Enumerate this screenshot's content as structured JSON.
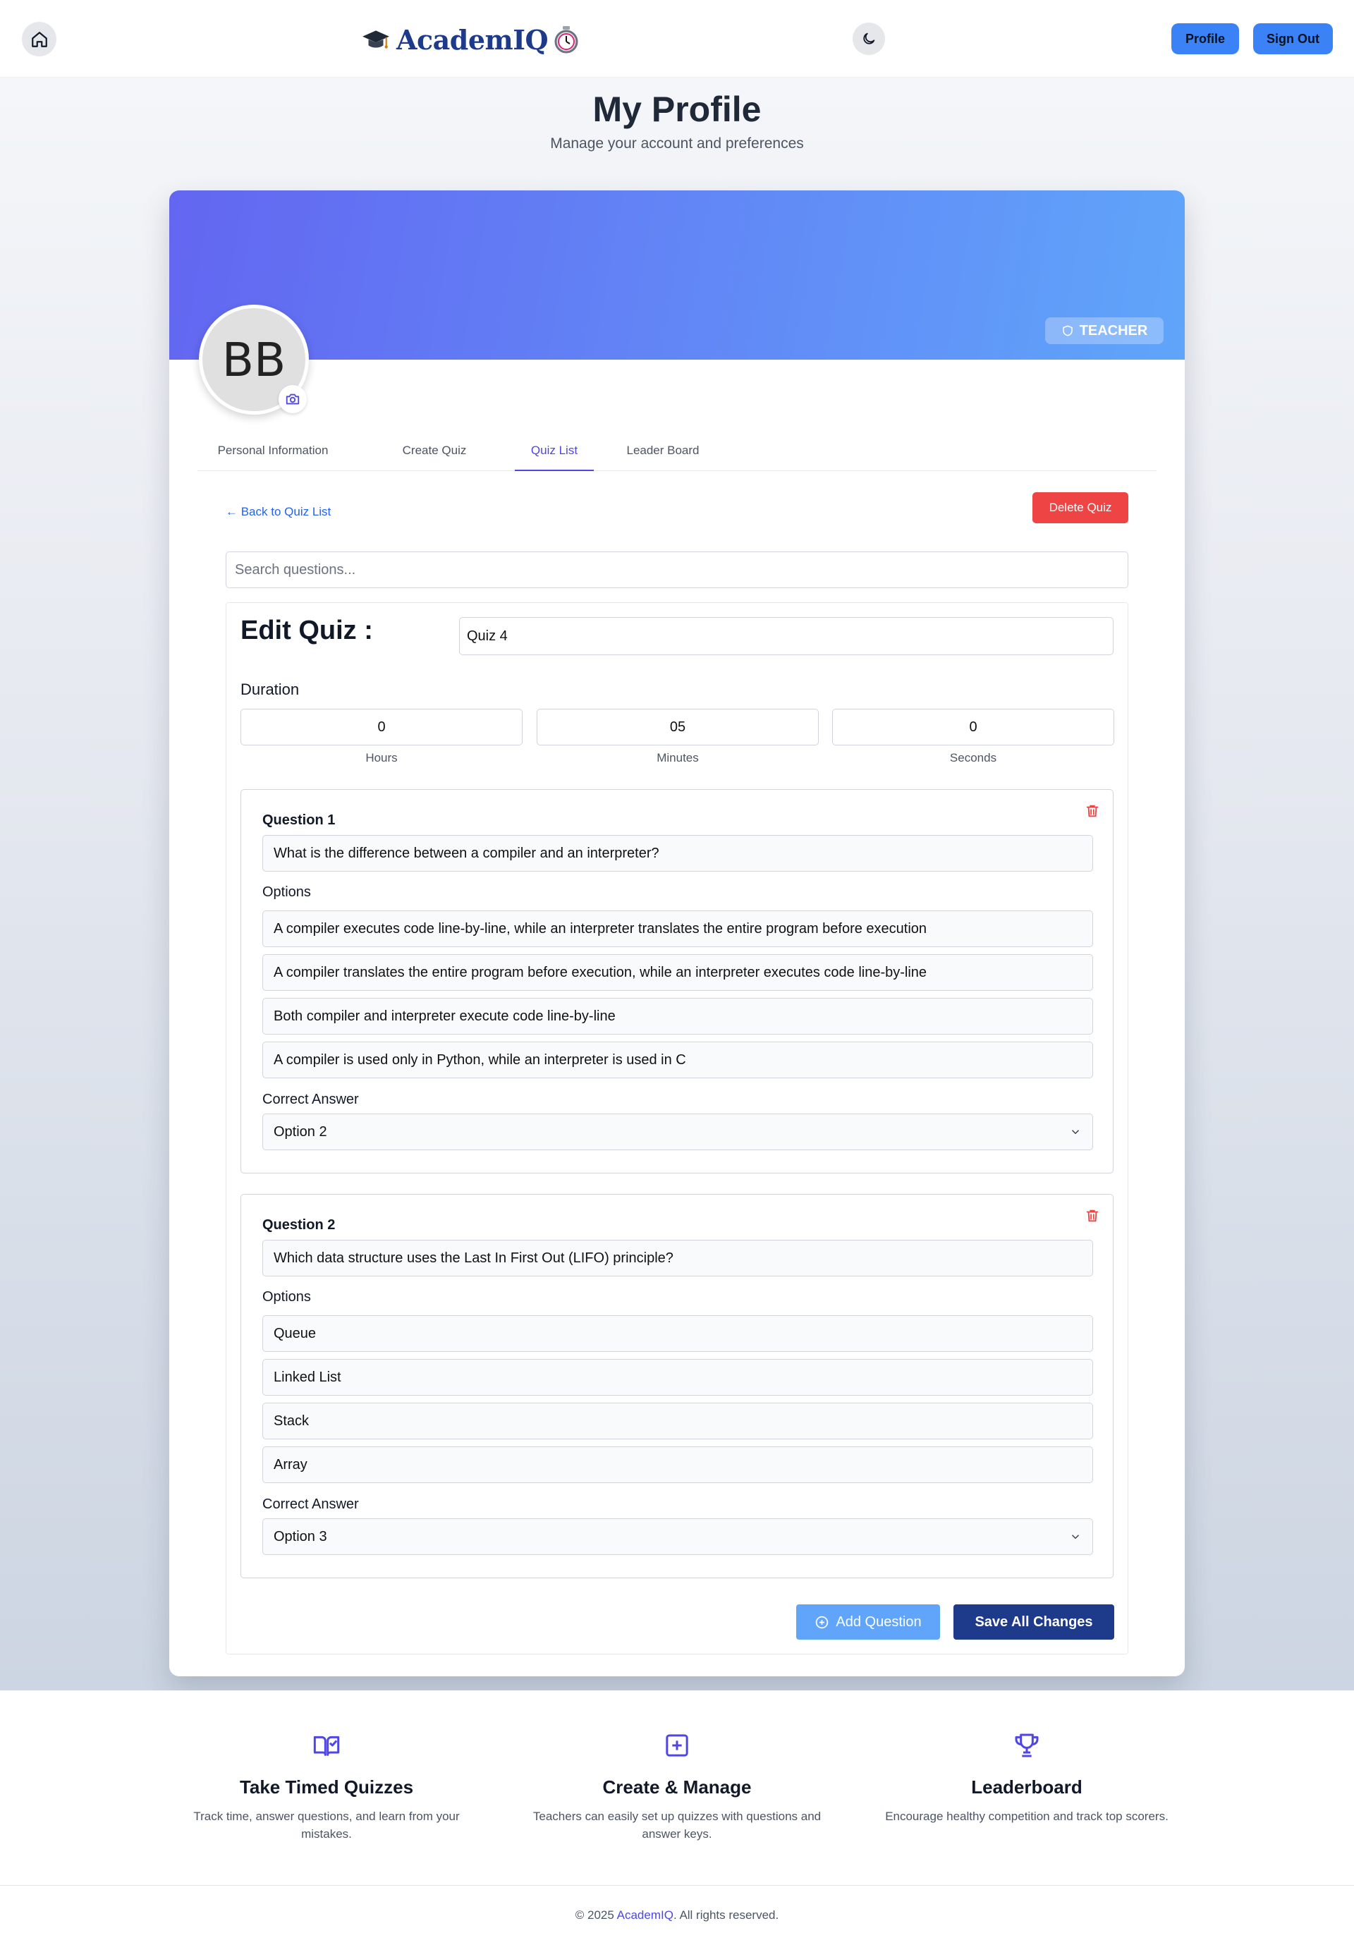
{
  "header": {
    "brand": "AcademIQ",
    "profile_label": "Profile",
    "signout_label": "Sign Out"
  },
  "page": {
    "title": "My Profile",
    "subtitle": "Manage your account and preferences"
  },
  "profile": {
    "initials": "BB",
    "role": "TEACHER"
  },
  "tabs": [
    {
      "label": "Personal Information",
      "active": false
    },
    {
      "label": "Create Quiz",
      "active": false
    },
    {
      "label": "Quiz List",
      "active": true
    },
    {
      "label": "Leader Board",
      "active": false
    }
  ],
  "quiz_editor": {
    "back_label": "← Back to Quiz List",
    "delete_label": "Delete Quiz",
    "search_placeholder": "Search questions...",
    "edit_title": "Edit Quiz :",
    "quiz_name": "Quiz 4",
    "duration_label": "Duration",
    "duration": {
      "hours": "0",
      "minutes": "05",
      "seconds": "0",
      "hours_label": "Hours",
      "minutes_label": "Minutes",
      "seconds_label": "Seconds"
    },
    "options_label": "Options",
    "correct_label": "Correct Answer",
    "questions": [
      {
        "label": "Question 1",
        "text": "What is the difference between a compiler and an interpreter?",
        "options": [
          "A compiler executes code line-by-line, while an interpreter translates the entire program before execution",
          "A compiler translates the entire program before execution, while an interpreter executes code line-by-line",
          "Both compiler and interpreter execute code line-by-line",
          "A compiler is used only in Python, while an interpreter is used in C"
        ],
        "correct": "Option 2"
      },
      {
        "label": "Question 2",
        "text": "Which data structure uses the Last In First Out (LIFO) principle?",
        "options": [
          "Queue",
          "Linked List",
          "Stack",
          "Array"
        ],
        "correct": "Option 3"
      }
    ],
    "add_question_label": "Add Question",
    "save_label": "Save All Changes"
  },
  "features": [
    {
      "title": "Take Timed Quizzes",
      "text": "Track time, answer questions, and learn from your mistakes.",
      "icon": "book-check-icon"
    },
    {
      "title": "Create & Manage",
      "text": "Teachers can easily set up quizzes with questions and answer keys.",
      "icon": "plus-square-icon"
    },
    {
      "title": "Leaderboard",
      "text": "Encourage healthy competition and track top scorers.",
      "icon": "trophy-icon"
    }
  ],
  "footer": {
    "prefix": "© 2025 ",
    "brand": "AcademIQ",
    "suffix": ". All rights reserved."
  },
  "colors": {
    "accent": "#4f46e5",
    "primary_button": "#3b82f6",
    "danger": "#ef4444",
    "save": "#1e3a8a"
  }
}
